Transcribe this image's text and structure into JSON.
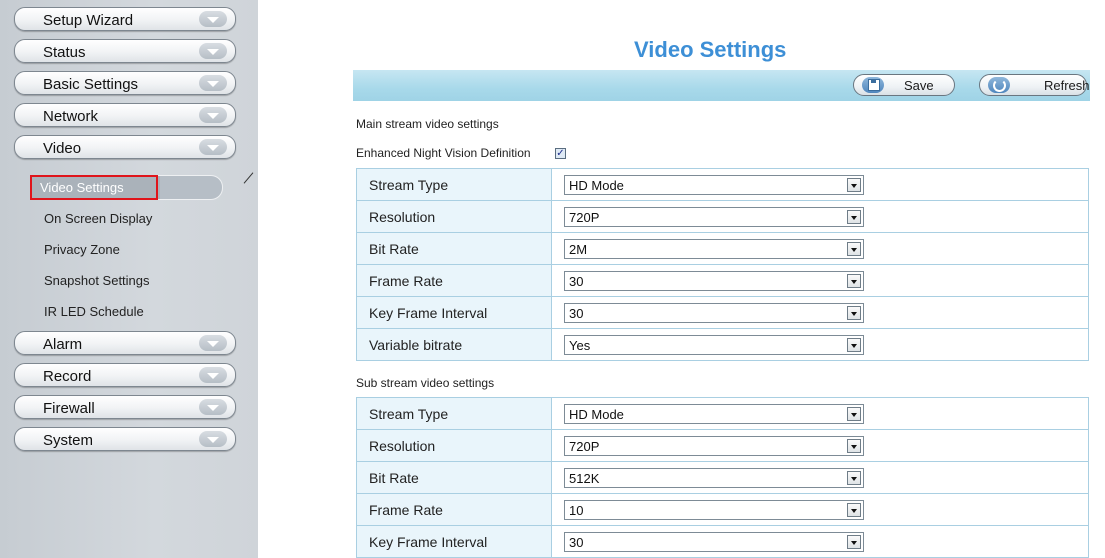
{
  "sidebar": {
    "menu": [
      {
        "label": "Setup Wizard"
      },
      {
        "label": "Status"
      },
      {
        "label": "Basic Settings"
      },
      {
        "label": "Network"
      },
      {
        "label": "Video"
      },
      {
        "label": "Alarm"
      },
      {
        "label": "Record"
      },
      {
        "label": "Firewall"
      },
      {
        "label": "System"
      }
    ],
    "video_submenu": [
      {
        "label": "Video Settings",
        "active": true
      },
      {
        "label": "On Screen Display"
      },
      {
        "label": "Privacy Zone"
      },
      {
        "label": "Snapshot Settings"
      },
      {
        "label": "IR LED Schedule"
      }
    ]
  },
  "main": {
    "title": "Video Settings",
    "toolbar": {
      "save_label": "Save",
      "refresh_label": "Refresh"
    },
    "main_stream": {
      "label": "Main stream video settings",
      "night_vision_label": "Enhanced Night Vision Definition",
      "night_vision_checked": true,
      "rows": [
        {
          "key": "Stream Type",
          "value": "HD Mode"
        },
        {
          "key": "Resolution",
          "value": "720P"
        },
        {
          "key": "Bit Rate",
          "value": "2M"
        },
        {
          "key": "Frame Rate",
          "value": "30"
        },
        {
          "key": "Key Frame Interval",
          "value": "30"
        },
        {
          "key": "Variable bitrate",
          "value": "Yes"
        }
      ]
    },
    "sub_stream": {
      "label": "Sub stream video settings",
      "rows": [
        {
          "key": "Stream Type",
          "value": "HD Mode"
        },
        {
          "key": "Resolution",
          "value": "720P"
        },
        {
          "key": "Bit Rate",
          "value": "512K"
        },
        {
          "key": "Frame Rate",
          "value": "10"
        },
        {
          "key": "Key Frame Interval",
          "value": "30"
        }
      ]
    }
  },
  "colors": {
    "title": "#3d8fd6",
    "toolbar": "#a8d9ea",
    "highlight_box": "#e0141b",
    "sidebar": "#d3d8dd"
  },
  "icons": {
    "menu_expand": "chevron-down-icon",
    "save": "floppy-disk-icon",
    "refresh": "refresh-icon"
  }
}
